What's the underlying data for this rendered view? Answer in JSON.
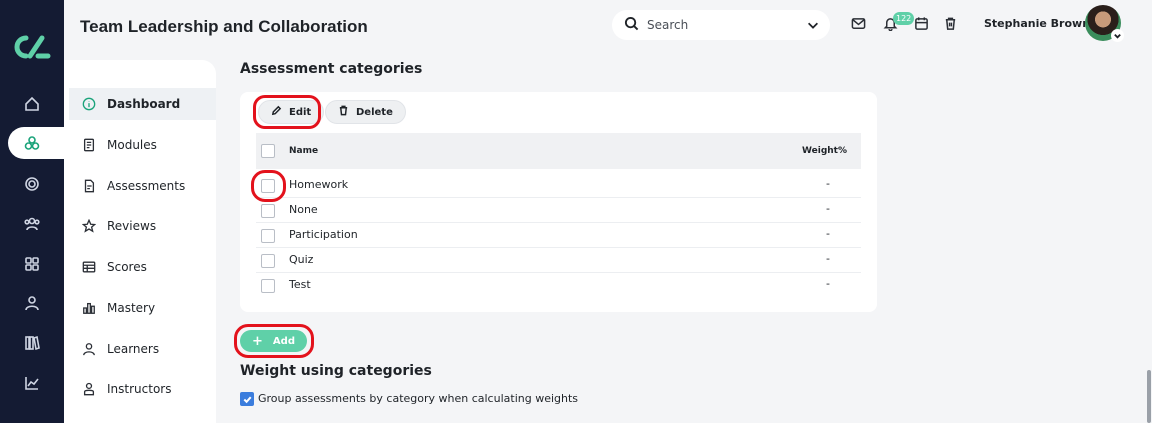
{
  "header": {
    "title": "Team Leadership and Collaboration",
    "search_placeholder": "Search",
    "notification_count": "122",
    "user_name": "Stephanie Brown"
  },
  "rail": {
    "icons": [
      "home-icon",
      "network-icon",
      "target-icon",
      "users-icon",
      "grid-icon",
      "person-icon",
      "library-icon",
      "chart-line-icon"
    ]
  },
  "sidebar": {
    "items": [
      {
        "label": "Dashboard",
        "icon": "info-icon",
        "active": true
      },
      {
        "label": "Modules",
        "icon": "document-icon"
      },
      {
        "label": "Assessments",
        "icon": "clipboard-icon"
      },
      {
        "label": "Reviews",
        "icon": "star-icon"
      },
      {
        "label": "Scores",
        "icon": "table-icon"
      },
      {
        "label": "Mastery",
        "icon": "bar-chart-icon"
      },
      {
        "label": "Learners",
        "icon": "person-icon"
      },
      {
        "label": "Instructors",
        "icon": "instructor-icon"
      }
    ]
  },
  "main": {
    "section_title": "Assessment categories",
    "toolbar": {
      "edit_label": "Edit",
      "delete_label": "Delete"
    },
    "table": {
      "headers": {
        "name": "Name",
        "weight": "Weight%"
      },
      "rows": [
        {
          "name": "Homework",
          "weight": "-"
        },
        {
          "name": "None",
          "weight": "-"
        },
        {
          "name": "Participation",
          "weight": "-"
        },
        {
          "name": "Quiz",
          "weight": "-"
        },
        {
          "name": "Test",
          "weight": "-"
        }
      ]
    },
    "add_label": "Add",
    "weight_title": "Weight using categories",
    "group_checkbox_label": "Group assessments by category when calculating weights",
    "group_checkbox_checked": true
  },
  "colors": {
    "accent": "#5fd0a8",
    "rail_bg": "#141b33",
    "highlight_ring": "#e3121c",
    "checkbox": "#3b7ddd"
  }
}
